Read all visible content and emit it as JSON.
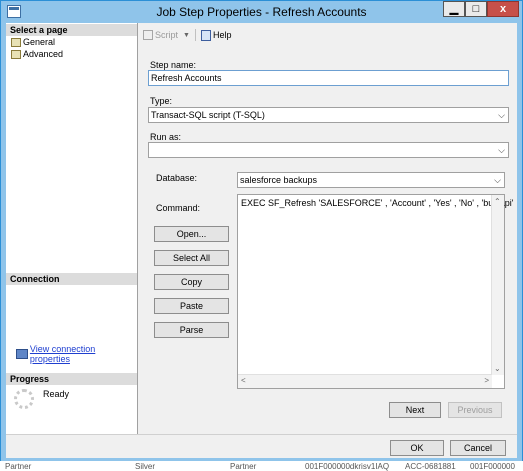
{
  "window": {
    "title": "Job Step Properties - Refresh Accounts",
    "minimize_glyph": "▁",
    "maximize_glyph": "□",
    "close_glyph": "x"
  },
  "left_pane": {
    "select_page_heading": "Select a page",
    "pages": [
      {
        "label": "General",
        "icon": "page-icon"
      },
      {
        "label": "Advanced",
        "icon": "page-icon"
      }
    ],
    "connection_heading": "Connection",
    "connection_link": "View connection properties",
    "progress_heading": "Progress",
    "progress_status": "Ready"
  },
  "toolbar": {
    "script_label": "Script",
    "help_label": "Help"
  },
  "form": {
    "step_name_label": "Step name:",
    "step_name_value": "Refresh Accounts",
    "type_label": "Type:",
    "type_value": "Transact-SQL script (T-SQL)",
    "run_as_label": "Run as:",
    "run_as_value": "",
    "database_label": "Database:",
    "database_value": "salesforce backups",
    "command_label": "Command:",
    "command_text": "EXEC SF_Refresh 'SALESFORCE' , 'Account' , 'Yes' , 'No' , 'bulkapi'"
  },
  "command_buttons": {
    "open": "Open...",
    "select_all": "Select All",
    "copy": "Copy",
    "paste": "Paste",
    "parse": "Parse"
  },
  "nav_buttons": {
    "next": "Next",
    "previous": "Previous"
  },
  "dialog_buttons": {
    "ok": "OK",
    "cancel": "Cancel"
  },
  "background_row": [
    "Partner",
    "Silver",
    "Partner",
    "001F000000dkrisv1IAQ",
    "ACC-0681881",
    "001F000000"
  ],
  "colors": {
    "title_bar": "#8fc4ea",
    "close_button": "#c7504a",
    "link": "#1f3fd0",
    "dialog_bg": "#f0f0f0"
  }
}
